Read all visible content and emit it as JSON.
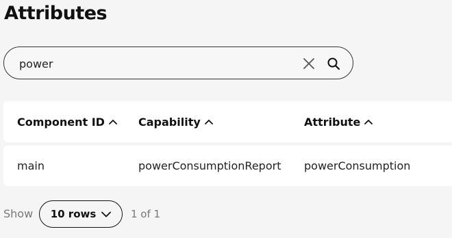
{
  "page": {
    "title": "Attributes"
  },
  "search": {
    "value": "power",
    "clear_icon": "close-icon",
    "search_icon": "search-icon"
  },
  "table": {
    "columns": [
      {
        "label": "Component ID",
        "sort": "ascending"
      },
      {
        "label": "Capability",
        "sort": "ascending"
      },
      {
        "label": "Attribute",
        "sort": "ascending"
      }
    ],
    "rows": [
      {
        "component_id": "main",
        "capability": "powerConsumptionReport",
        "attribute": "powerConsumption"
      }
    ]
  },
  "pagination": {
    "show_label": "Show",
    "rows_per_page": "10 rows",
    "page_info": "1 of 1"
  }
}
